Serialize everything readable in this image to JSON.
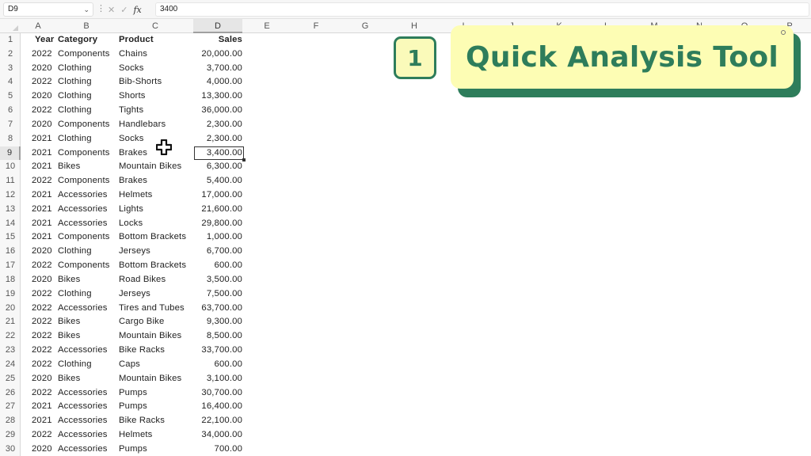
{
  "formula_bar": {
    "name_box": "D9",
    "name_box_chevron": "chevron-down-icon",
    "cancel_icon": "✕",
    "enter_icon": "✓",
    "fx_label": "fx",
    "formula_value": "3400"
  },
  "columns": [
    "A",
    "B",
    "C",
    "D",
    "E",
    "F",
    "G",
    "H",
    "I",
    "J",
    "K",
    "L",
    "M",
    "N",
    "O",
    "P"
  ],
  "selected_column": "D",
  "selected_row": 9,
  "active_cell": "D9",
  "table": {
    "headers": [
      "Year",
      "Category",
      "Product",
      "Sales"
    ],
    "rows": [
      [
        "2022",
        "Components",
        "Chains",
        "20,000.00"
      ],
      [
        "2020",
        "Clothing",
        "Socks",
        "3,700.00"
      ],
      [
        "2022",
        "Clothing",
        "Bib-Shorts",
        "4,000.00"
      ],
      [
        "2020",
        "Clothing",
        "Shorts",
        "13,300.00"
      ],
      [
        "2022",
        "Clothing",
        "Tights",
        "36,000.00"
      ],
      [
        "2020",
        "Components",
        "Handlebars",
        "2,300.00"
      ],
      [
        "2021",
        "Clothing",
        "Socks",
        "2,300.00"
      ],
      [
        "2021",
        "Components",
        "Brakes",
        "3,400.00"
      ],
      [
        "2021",
        "Bikes",
        "Mountain Bikes",
        "6,300.00"
      ],
      [
        "2022",
        "Components",
        "Brakes",
        "5,400.00"
      ],
      [
        "2021",
        "Accessories",
        "Helmets",
        "17,000.00"
      ],
      [
        "2021",
        "Accessories",
        "Lights",
        "21,600.00"
      ],
      [
        "2021",
        "Accessories",
        "Locks",
        "29,800.00"
      ],
      [
        "2021",
        "Components",
        "Bottom Brackets",
        "1,000.00"
      ],
      [
        "2020",
        "Clothing",
        "Jerseys",
        "6,700.00"
      ],
      [
        "2022",
        "Components",
        "Bottom Brackets",
        "600.00"
      ],
      [
        "2020",
        "Bikes",
        "Road Bikes",
        "3,500.00"
      ],
      [
        "2022",
        "Clothing",
        "Jerseys",
        "7,500.00"
      ],
      [
        "2022",
        "Accessories",
        "Tires and Tubes",
        "63,700.00"
      ],
      [
        "2022",
        "Bikes",
        "Cargo Bike",
        "9,300.00"
      ],
      [
        "2022",
        "Bikes",
        "Mountain Bikes",
        "8,500.00"
      ],
      [
        "2022",
        "Accessories",
        "Bike Racks",
        "33,700.00"
      ],
      [
        "2022",
        "Clothing",
        "Caps",
        "600.00"
      ],
      [
        "2020",
        "Bikes",
        "Mountain Bikes",
        "3,100.00"
      ],
      [
        "2022",
        "Accessories",
        "Pumps",
        "30,700.00"
      ],
      [
        "2021",
        "Accessories",
        "Pumps",
        "16,400.00"
      ],
      [
        "2021",
        "Accessories",
        "Bike Racks",
        "22,100.00"
      ],
      [
        "2022",
        "Accessories",
        "Helmets",
        "34,000.00"
      ],
      [
        "2020",
        "Accessories",
        "Pumps",
        "700.00"
      ]
    ]
  },
  "overlay": {
    "step_number": "1",
    "title": "Quick Analysis Tool",
    "colors": {
      "accent": "#2e7d5b",
      "card": "#fdfdb4"
    }
  },
  "cursor": "cell-select-cross-icon"
}
